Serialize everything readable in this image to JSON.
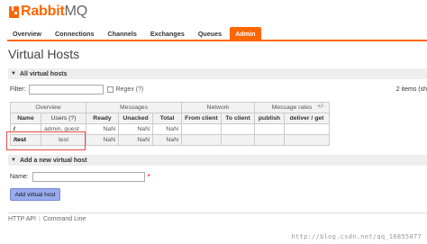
{
  "brand": {
    "name_main": "Rabbit",
    "name_suffix": "MQ"
  },
  "nav": {
    "tabs": [
      {
        "label": "Overview"
      },
      {
        "label": "Connections"
      },
      {
        "label": "Channels"
      },
      {
        "label": "Exchanges"
      },
      {
        "label": "Queues"
      },
      {
        "label": "Admin",
        "active": true
      }
    ]
  },
  "page": {
    "title": "Virtual Hosts"
  },
  "all_vhosts": {
    "heading": "All virtual hosts",
    "filter_label": "Filter:",
    "filter_value": "",
    "regex_label": "Regex (?)",
    "items_count": "2 items (sh",
    "toggle_columns": "+/-",
    "groups": {
      "overview": "Overview",
      "messages": "Messages",
      "network": "Network",
      "rates": "Message rates"
    },
    "columns": [
      "Name",
      "Users (?)",
      "Ready",
      "Unacked",
      "Total",
      "From client",
      "To client",
      "publish",
      "deliver / get"
    ],
    "rows": [
      {
        "name": "/",
        "users": "admin, guest",
        "ready": "NaN",
        "unacked": "NaN",
        "total": "NaN",
        "from_client": "",
        "to_client": "",
        "publish": "",
        "deliver": ""
      },
      {
        "name": "/test",
        "users": "test",
        "ready": "NaN",
        "unacked": "NaN",
        "total": "NaN",
        "from_client": "",
        "to_client": "",
        "publish": "",
        "deliver": ""
      }
    ]
  },
  "add_vhost": {
    "heading": "Add a new virtual host",
    "name_label": "Name:",
    "name_value": "",
    "required_mark": "*",
    "button_label": "Add virtual host"
  },
  "footer": {
    "links": [
      "HTTP API",
      "Command Line"
    ]
  },
  "watermark": "http://blog.csdn.net/qq_16855077",
  "colors": {
    "accent": "#ff6600",
    "button": "#99aaee",
    "highlight": "#e84a4a"
  }
}
